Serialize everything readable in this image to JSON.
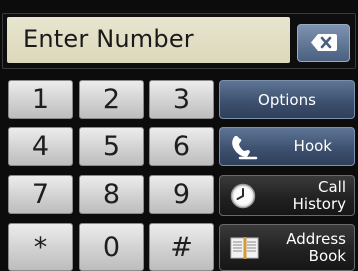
{
  "entry": {
    "placeholder": "Enter Number",
    "backspace_icon": "backspace-icon"
  },
  "keypad": {
    "keys": [
      "1",
      "2",
      "3",
      "4",
      "5",
      "6",
      "7",
      "8",
      "9",
      "*",
      "0",
      "#"
    ]
  },
  "actions": {
    "options": {
      "label": "Options"
    },
    "hook": {
      "label": "Hook",
      "icon": "phone-handset-icon"
    },
    "call_history": {
      "line1": "Call",
      "line2": "History",
      "icon": "clock-icon"
    },
    "address_book": {
      "line1": "Address",
      "line2": "Book",
      "icon": "book-icon"
    }
  },
  "colors": {
    "accent_blue": "#3e5170",
    "entry_background": "#dcd8bb",
    "key_background": "#d4d4d4"
  }
}
